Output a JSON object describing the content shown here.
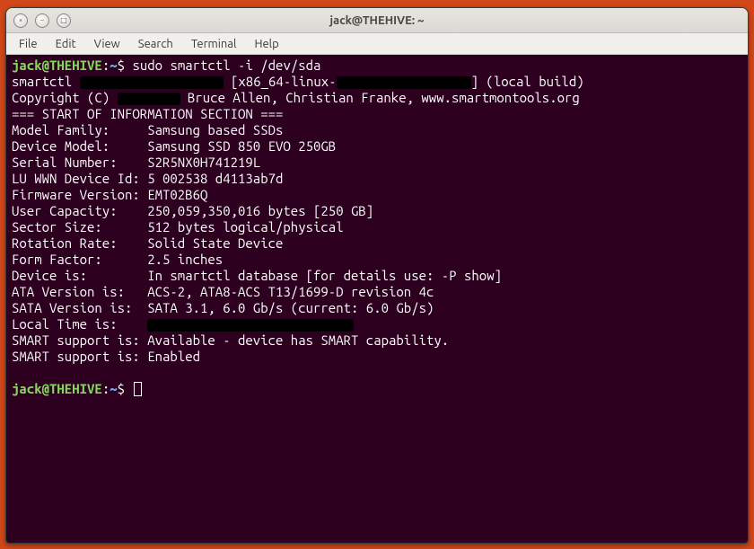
{
  "window": {
    "title": "jack@THEHIVE: ~"
  },
  "controls": {
    "close": "×",
    "min": "−",
    "max": "□"
  },
  "menu": {
    "file": "File",
    "edit": "Edit",
    "view": "View",
    "search": "Search",
    "terminal": "Terminal",
    "help": "Help"
  },
  "prompt": {
    "userhost": "jack@THEHIVE",
    "sep": ":",
    "path": "~",
    "dollar": "$ "
  },
  "cmd1": "sudo smartctl -i /dev/sda",
  "out": {
    "l1a": "smartctl ",
    "l1b": " [x86_64-linux-",
    "l1c": "] (local build)",
    "l2a": "Copyright (C) ",
    "l2b": " Bruce Allen, Christian Franke, www.smartmontools.org",
    "blank1": "",
    "l3": "=== START OF INFORMATION SECTION ===",
    "l4": "Model Family:     Samsung based SSDs",
    "l5": "Device Model:     Samsung SSD 850 EVO 250GB",
    "l6": "Serial Number:    S2R5NX0H741219L",
    "l7": "LU WWN Device Id: 5 002538 d4113ab7d",
    "l8": "Firmware Version: EMT02B6Q",
    "l9": "User Capacity:    250,059,350,016 bytes [250 GB]",
    "l10": "Sector Size:      512 bytes logical/physical",
    "l11": "Rotation Rate:    Solid State Device",
    "l12": "Form Factor:      2.5 inches",
    "l13": "Device is:        In smartctl database [for details use: -P show]",
    "l14": "ATA Version is:   ACS-2, ATA8-ACS T13/1699-D revision 4c",
    "l15": "SATA Version is:  SATA 3.1, 6.0 Gb/s (current: 6.0 Gb/s)",
    "l16": "Local Time is:    ",
    "l17": "SMART support is: Available - device has SMART capability.",
    "l18": "SMART support is: Enabled"
  }
}
